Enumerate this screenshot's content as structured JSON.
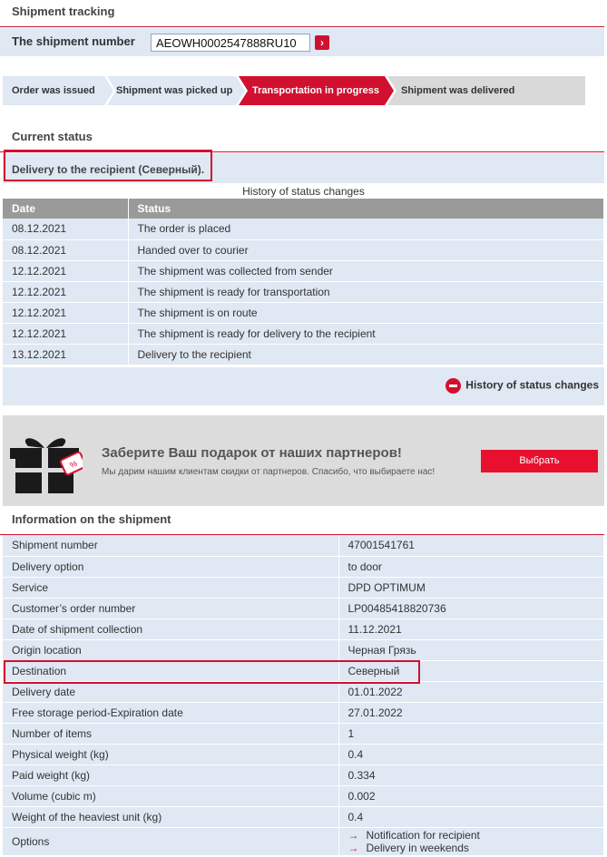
{
  "tracking": {
    "title": "Shipment tracking",
    "label": "The shipment number",
    "value": "AEOWH0002547888RU10",
    "go": "›"
  },
  "steps": [
    {
      "label": "Order was issued",
      "active": false
    },
    {
      "label": "Shipment was picked up",
      "active": false
    },
    {
      "label": "Transportation in progress",
      "active": true
    },
    {
      "label": "Shipment was delivered",
      "active": false
    }
  ],
  "current_status": {
    "title": "Current status",
    "text": "Delivery to the recipient (Северный)."
  },
  "history": {
    "caption": "History of status changes",
    "headers": [
      "Date",
      "Status"
    ],
    "rows": [
      [
        "08.12.2021",
        "The order is placed"
      ],
      [
        "08.12.2021",
        "Handed over to courier"
      ],
      [
        "12.12.2021",
        "The shipment was collected from sender"
      ],
      [
        "12.12.2021",
        "The shipment is ready for transportation"
      ],
      [
        "12.12.2021",
        "The shipment is on route"
      ],
      [
        "12.12.2021",
        "The shipment is ready for delivery to the recipient"
      ],
      [
        "13.12.2021",
        "Delivery to the recipient"
      ]
    ],
    "toggle_label": "History of status changes"
  },
  "promo": {
    "title": "Заберите Ваш подарок от наших партнеров!",
    "subtitle": "Мы дарим нашим клиентам скидки от партнеров. Спасибо, что выбираете нас!",
    "button": "Выбрать",
    "badge": "%"
  },
  "info": {
    "title": "Information on the shipment",
    "rows": [
      [
        "Shipment number",
        "47001541761"
      ],
      [
        "Delivery option",
        "to door"
      ],
      [
        "Service",
        "DPD OPTIMUM"
      ],
      [
        "Customer’s order number",
        "LP00485418820736"
      ],
      [
        "Date of shipment collection",
        "11.12.2021"
      ],
      [
        "Origin location",
        "Черная Грязь"
      ],
      [
        "Destination",
        "Северный"
      ],
      [
        "Delivery date",
        "01.01.2022"
      ],
      [
        "Free storage period-Expiration date",
        "27.01.2022"
      ],
      [
        "Number of items",
        "1"
      ],
      [
        "Physical weight (kg)",
        "0.4"
      ],
      [
        "Paid weight (kg)",
        "0.334"
      ],
      [
        "Volume (cubic m)",
        "0.002"
      ],
      [
        "Weight of the heaviest unit (kg)",
        "0.4"
      ]
    ],
    "options_label": "Options",
    "options": [
      "Notification for recipient",
      "Delivery in weekends"
    ]
  },
  "colors": {
    "accent": "#d11030",
    "row_bg": "#dfe8f3",
    "header_gray": "#9a9a9a",
    "promo_bg": "#dcdcdc"
  }
}
